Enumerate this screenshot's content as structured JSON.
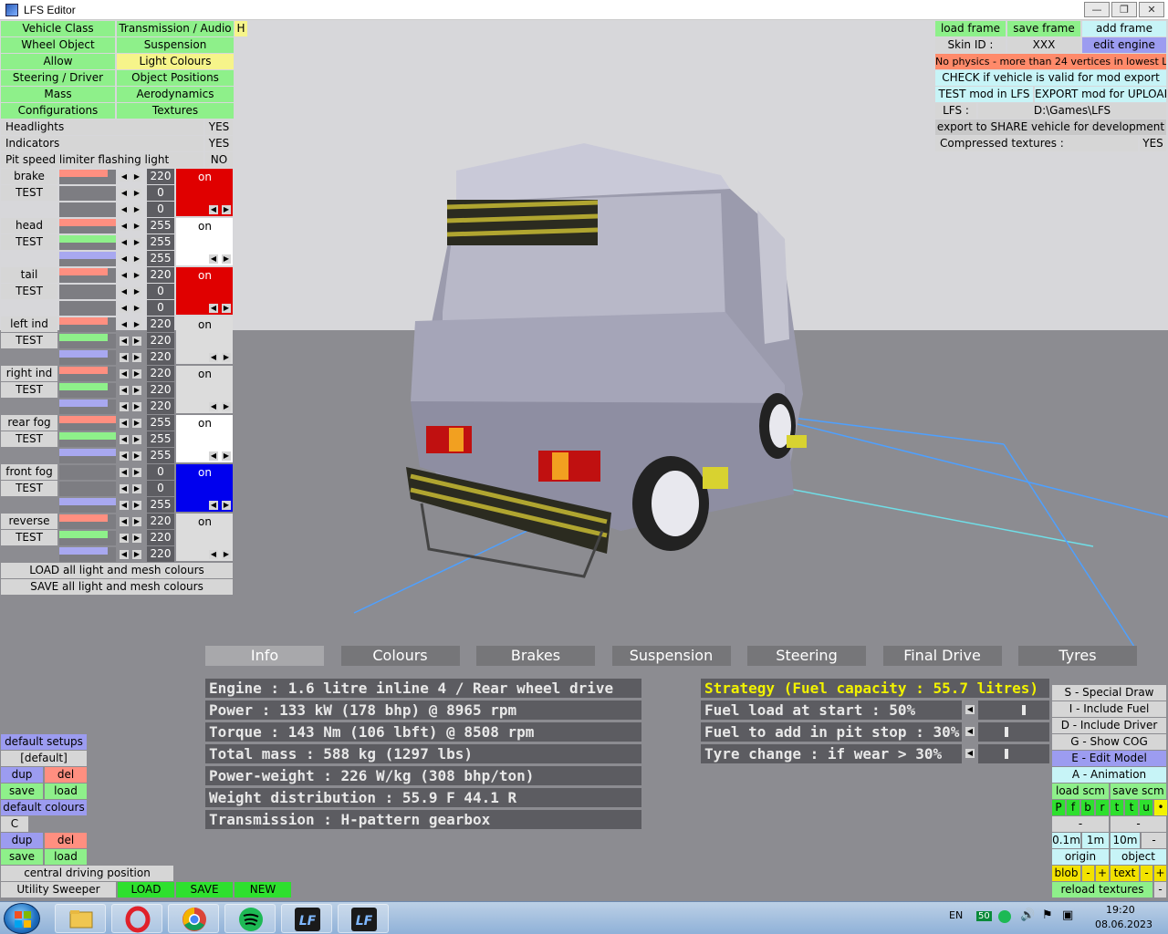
{
  "window": {
    "title": "LFS Editor"
  },
  "menu": {
    "vehicle_class": "Vehicle Class",
    "transmission_audio": "Transmission / Audio",
    "h": "H",
    "wheel_object": "Wheel Object",
    "suspension": "Suspension",
    "allow": "Allow",
    "light_colours": "Light Colours",
    "steering_driver": "Steering / Driver",
    "object_positions": "Object Positions",
    "mass": "Mass",
    "aerodynamics": "Aerodynamics",
    "configurations": "Configurations",
    "textures": "Textures"
  },
  "options": [
    {
      "label": "Headlights",
      "value": "YES"
    },
    {
      "label": "Indicators",
      "value": "YES"
    },
    {
      "label": "Pit speed limiter flashing light",
      "value": "NO"
    }
  ],
  "lights": [
    {
      "name": "brake",
      "test": "TEST",
      "r": "220",
      "g": "0",
      "b": "0",
      "state": "on",
      "swatch": "#e00000"
    },
    {
      "name": "head",
      "test": "TEST",
      "r": "255",
      "g": "255",
      "b": "255",
      "state": "on",
      "swatch": "#ffffff"
    },
    {
      "name": "tail",
      "test": "TEST",
      "r": "220",
      "g": "0",
      "b": "0",
      "state": "on",
      "swatch": "#e00000"
    },
    {
      "name": "left ind",
      "test": "TEST",
      "r": "220",
      "g": "220",
      "b": "220",
      "state": "on",
      "swatch": "#dcdcdc"
    },
    {
      "name": "right ind",
      "test": "TEST",
      "r": "220",
      "g": "220",
      "b": "220",
      "state": "on",
      "swatch": "#dcdcdc"
    },
    {
      "name": "rear fog",
      "test": "TEST",
      "r": "255",
      "g": "255",
      "b": "255",
      "state": "on",
      "swatch": "#ffffff"
    },
    {
      "name": "front fog",
      "test": "TEST",
      "r": "0",
      "g": "0",
      "b": "255",
      "state": "on",
      "swatch": "#0000ee"
    },
    {
      "name": "reverse",
      "test": "TEST",
      "r": "220",
      "g": "220",
      "b": "220",
      "state": "on",
      "swatch": "#dcdcdc"
    }
  ],
  "light_actions": {
    "load": "LOAD all light and mesh colours",
    "save": "SAVE all light and mesh colours"
  },
  "right_panel": {
    "load_frame": "load frame",
    "save_frame": "save frame",
    "add_frame": "add frame",
    "skin_id": "Skin ID :",
    "skin_value": "XXX",
    "edit_engine": "edit engine",
    "warning": "No physics - more than 24 vertices in lowest LOD",
    "check": "CHECK if vehicle is valid for mod export",
    "test_mod": "TEST mod in LFS",
    "export_mod": "EXPORT mod for UPLOAD",
    "lfs_label": "LFS :",
    "lfs_path": "D:\\Games\\LFS",
    "export_share": "export to SHARE vehicle for development",
    "compressed": "Compressed textures :",
    "compressed_value": "YES"
  },
  "tabs": [
    "Info",
    "Colours",
    "Brakes",
    "Suspension",
    "Steering",
    "Final Drive",
    "Tyres"
  ],
  "info_lines": [
    "Engine : 1.6 litre inline 4 / Rear wheel drive",
    "Power : 133 kW (178 bhp) @ 8965 rpm",
    "Torque : 143 Nm (106 lbft) @ 8508 rpm",
    "Total mass : 588 kg (1297 lbs)",
    "Power-weight : 226 W/kg (308 bhp/ton)",
    "Weight distribution : 55.9 F  44.1 R",
    "Transmission : H-pattern gearbox"
  ],
  "strategy": {
    "title": "Strategy (Fuel capacity : 55.7 litres)",
    "rows": [
      {
        "label": "Fuel load at start : 50%",
        "level": 0.5
      },
      {
        "label": "Fuel to add in pit stop : 30%",
        "level": 0.3
      },
      {
        "label": "Tyre change : if wear > 30%",
        "level": 0.3
      }
    ]
  },
  "bottom_left": {
    "default_setups": "default setups",
    "default": "[default]",
    "dup": "dup",
    "del": "del",
    "save": "save",
    "load": "load",
    "default_colours": "default colours",
    "c": "C",
    "central": "central driving position",
    "vehicle": "Utility Sweeper",
    "btn_load": "LOAD",
    "btn_save": "SAVE",
    "btn_new": "NEW"
  },
  "bottom_right": {
    "special_draw": "S - Special Draw",
    "include_fuel": "I - Include Fuel",
    "include_driver": "D - Include Driver",
    "show_cog": "G - Show COG",
    "edit_model": "E - Edit Model",
    "animation": "A - Animation",
    "load_scm": "load scm",
    "save_scm": "save scm",
    "letters": [
      "P",
      "f",
      "b",
      "r",
      "t",
      "t",
      "u",
      "•"
    ],
    "minus": "-",
    "plus": "+",
    "step_01": "0.1m",
    "step_1": "1m",
    "step_10": "10m",
    "origin": "origin",
    "object": "object",
    "blob": "blob",
    "text": "text",
    "reload": "reload textures"
  },
  "taskbar": {
    "lang": "EN",
    "badge": "50",
    "time": "19:20",
    "date": "08.06.2023"
  }
}
